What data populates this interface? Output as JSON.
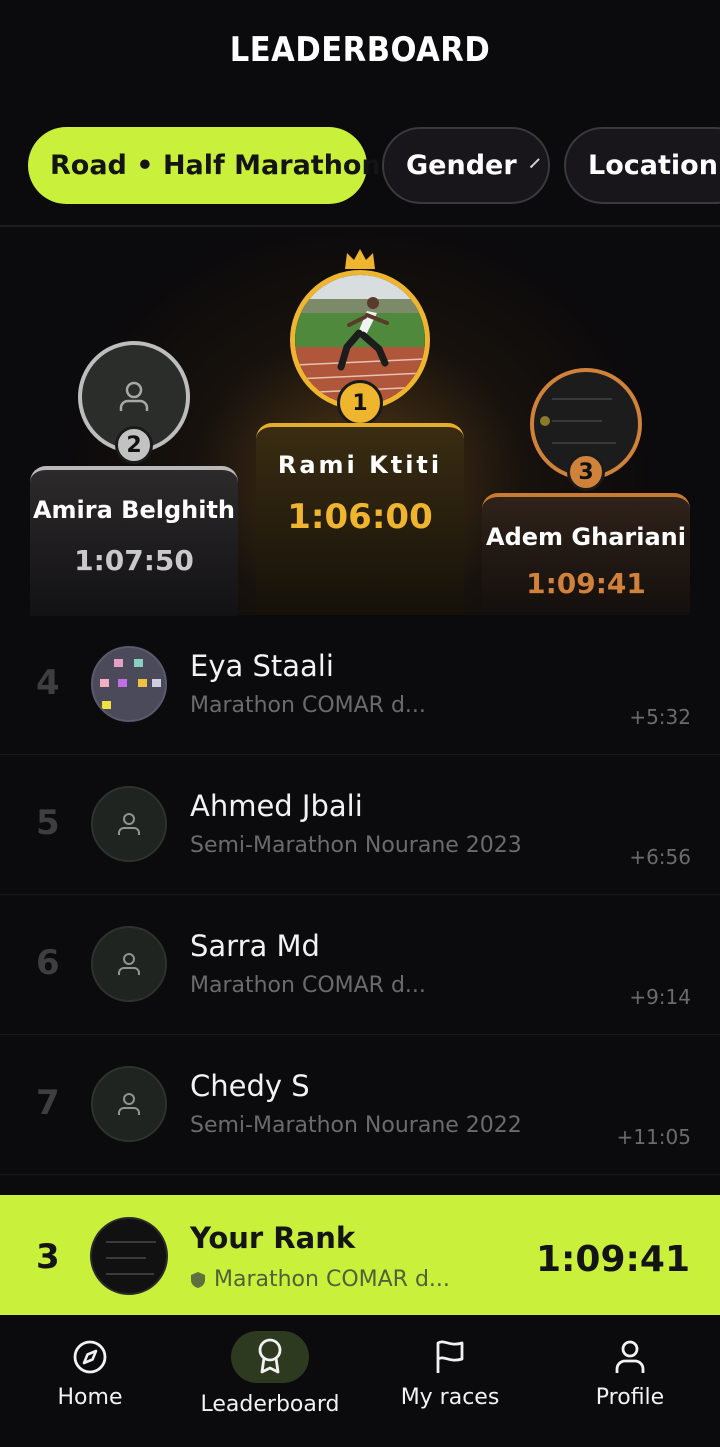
{
  "header": {
    "title": "LEADERBOARD"
  },
  "filters": [
    {
      "label": "Road • Half Marathon",
      "active": true
    },
    {
      "label": "Gender",
      "active": false
    },
    {
      "label": "Location",
      "active": false
    }
  ],
  "podium": {
    "first": {
      "rank": "1",
      "name": "Rami Ktiti",
      "time": "1:06:00"
    },
    "second": {
      "rank": "2",
      "name": "Amira Belghith",
      "time": "1:07:50"
    },
    "third": {
      "rank": "3",
      "name": "Adem Ghariani",
      "time": "1:09:41"
    }
  },
  "list": [
    {
      "rank": "4",
      "name": "Eya Staali",
      "race": "Marathon COMAR d...",
      "gap": "+5:32"
    },
    {
      "rank": "5",
      "name": "Ahmed Jbali",
      "race": "Semi-Marathon Nourane 2023",
      "gap": "+6:56"
    },
    {
      "rank": "6",
      "name": "Sarra Md",
      "race": "Marathon COMAR d...",
      "gap": "+9:14"
    },
    {
      "rank": "7",
      "name": "Chedy S",
      "race": "Semi-Marathon Nourane 2022",
      "gap": "+11:05"
    }
  ],
  "your_rank": {
    "rank": "3",
    "title": "Your Rank",
    "race": "Marathon COMAR d...",
    "time": "1:09:41"
  },
  "nav": [
    {
      "label": "Home",
      "icon": "compass-icon"
    },
    {
      "label": "Leaderboard",
      "icon": "award-icon",
      "active": true
    },
    {
      "label": "My races",
      "icon": "flag-icon"
    },
    {
      "label": "Profile",
      "icon": "user-icon"
    }
  ],
  "colors": {
    "accent": "#c9f03a",
    "gold": "#f0b52f",
    "silver": "#bdbdbd",
    "bronze": "#d0823a",
    "background": "#0b0a0c"
  }
}
